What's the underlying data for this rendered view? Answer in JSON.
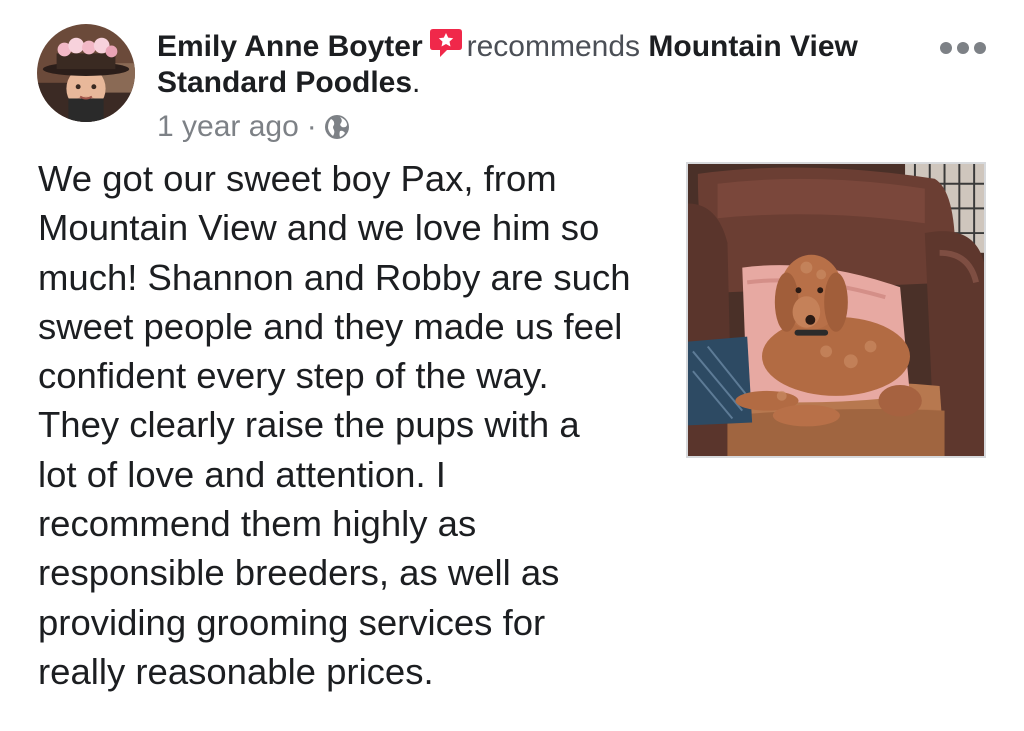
{
  "post": {
    "author": "Emily Anne Boyter",
    "verb": "recommends",
    "page_name": "Mountain View Standard Poodles",
    "punctuation": ".",
    "timestamp": "1 year ago",
    "separator": "·",
    "audience_icon": "globe-icon",
    "recommend_icon": "recommend-star-icon",
    "more_icon": "more-options-icon",
    "review": "We got our sweet boy Pax, from\nMountain View and we love him so\nmuch! Shannon and Robby are such\nsweet people and they made us feel\nconfident every step of the way.\nThey clearly raise the pups with a\nlot of love and attention. I\nrecommend them highly as\nresponsible breeders, as well as\nproviding grooming services for\nreally reasonable prices."
  },
  "colors": {
    "recommend_icon": "#f0284a",
    "secondary_text": "#7d8186",
    "primary_text": "#1c1e21"
  }
}
